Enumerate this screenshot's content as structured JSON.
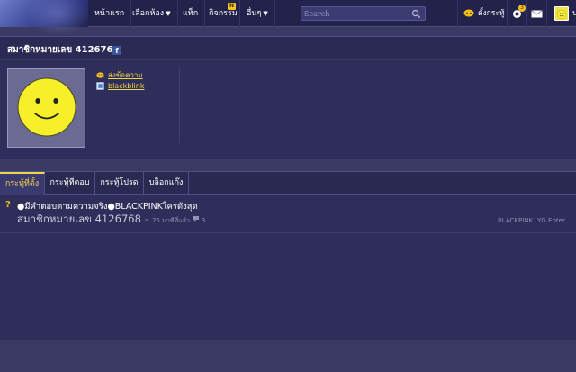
{
  "nav": {
    "items": [
      {
        "label": "หน้าแรก"
      },
      {
        "label": "เลือกห้อง",
        "arrow": "▼"
      },
      {
        "label": "แท็ก"
      },
      {
        "label": "กิจกรรม",
        "badge": "N"
      },
      {
        "label": "อื่นๆ",
        "arrow": "▼"
      }
    ],
    "search_placeholder": "Search",
    "post_label": "ตั้งกระทู้",
    "notification_count": "3",
    "user_label": "ป"
  },
  "profile": {
    "name": "สมาชิกหมายเลข 4126768",
    "links": [
      {
        "label": "ส่งข้อความ",
        "icon": "smiley-message-icon"
      },
      {
        "label": "blackblink",
        "icon": "blog-icon"
      }
    ]
  },
  "tabs": [
    {
      "label": "กระทู้ที่ตั้ง",
      "active": true
    },
    {
      "label": "กระทู้ที่ตอบ",
      "active": false
    },
    {
      "label": "กระทู้โปรด",
      "active": false
    },
    {
      "label": "บล็อกแก๊ง",
      "active": false
    }
  ],
  "topics": [
    {
      "icon": "?",
      "title": "●มีคำตอบตามความจริง●BLACKPINKใครดังสุด",
      "author": "สมาชิกหมายเลข 4126768",
      "separator": "-",
      "time": "25 นาทีที่แล้ว",
      "comments": "3",
      "tags": [
        "BLACKPINK",
        "YG Enter"
      ]
    }
  ],
  "colors": {
    "accent": "#f2d64a",
    "background": "#3b3a64",
    "panel": "#2f2e5a",
    "nav": "#23224a"
  }
}
